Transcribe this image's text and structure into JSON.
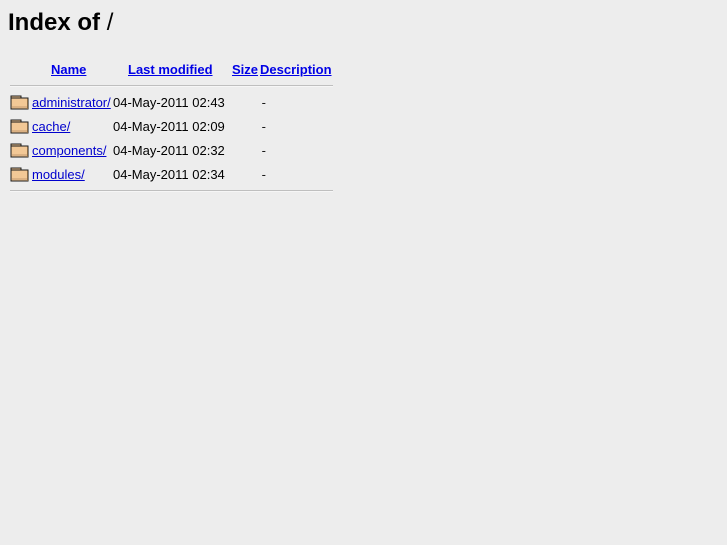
{
  "page": {
    "title_prefix": "Index of",
    "path": "/",
    "background_color": "#ededed",
    "link_color": "#0000cd",
    "header_link_color": "#0000e6",
    "rule_color": "#bfbfbf"
  },
  "table": {
    "headers": {
      "name": "Name",
      "last_modified": "Last modified",
      "size": "Size",
      "description": "Description"
    },
    "rows": [
      {
        "icon": "folder-icon",
        "name": "administrator/",
        "last_modified": "04-May-2011 02:43",
        "size": "-",
        "description": ""
      },
      {
        "icon": "folder-icon",
        "name": "cache/",
        "last_modified": "04-May-2011 02:09",
        "size": "-",
        "description": ""
      },
      {
        "icon": "folder-icon",
        "name": "components/",
        "last_modified": "04-May-2011 02:32",
        "size": "-",
        "description": ""
      },
      {
        "icon": "folder-icon",
        "name": "modules/",
        "last_modified": "04-May-2011 02:34",
        "size": "-",
        "description": ""
      }
    ]
  }
}
